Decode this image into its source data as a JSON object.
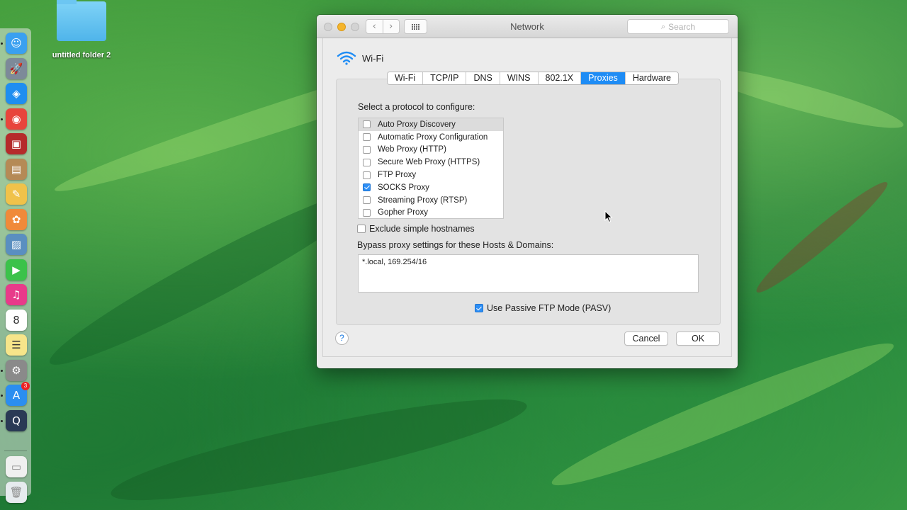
{
  "desktop": {
    "folder_label": "untitled folder 2"
  },
  "dock": {
    "items": [
      {
        "name": "finder",
        "glyph": "☺",
        "color": "#3aa0f0",
        "running": true
      },
      {
        "name": "launchpad",
        "glyph": "🚀",
        "color": "#7d8a99",
        "running": false
      },
      {
        "name": "safari",
        "glyph": "◈",
        "color": "#1f8ef0",
        "running": false
      },
      {
        "name": "chrome",
        "glyph": "◉",
        "color": "#e8453c",
        "running": true
      },
      {
        "name": "photo-booth",
        "glyph": "▣",
        "color": "#b52b2b",
        "running": false
      },
      {
        "name": "contacts",
        "glyph": "▤",
        "color": "#b58a56",
        "running": false
      },
      {
        "name": "notes-pencil",
        "glyph": "✎",
        "color": "#f0c24a",
        "running": false
      },
      {
        "name": "photos",
        "glyph": "✿",
        "color": "#f08a3a",
        "running": false
      },
      {
        "name": "preview",
        "glyph": "▨",
        "color": "#5a8fc0",
        "running": false
      },
      {
        "name": "facetime",
        "glyph": "▶",
        "color": "#3bc24a",
        "running": false
      },
      {
        "name": "itunes",
        "glyph": "♫",
        "color": "#e83a8a",
        "running": false
      },
      {
        "name": "calendar",
        "glyph": "8",
        "color": "#ffffff",
        "running": false
      },
      {
        "name": "notes",
        "glyph": "☰",
        "color": "#f6e58a",
        "running": false
      },
      {
        "name": "system-preferences",
        "glyph": "⚙",
        "color": "#8a8a8a",
        "running": true
      },
      {
        "name": "app-store",
        "glyph": "A",
        "color": "#2b8ef0",
        "running": true,
        "badge": "3"
      },
      {
        "name": "quicktime",
        "glyph": "Q",
        "color": "#2a3a55",
        "running": true
      }
    ],
    "bottom_items": [
      {
        "name": "downloads-stack",
        "glyph": "▭",
        "color": "#f0f0f0"
      },
      {
        "name": "trash",
        "glyph": "🗑",
        "color": "#e6ebee"
      }
    ]
  },
  "window": {
    "title": "Network",
    "search_placeholder": "Search",
    "interface_name": "Wi-Fi",
    "tabs": [
      {
        "label": "Wi-Fi",
        "active": false
      },
      {
        "label": "TCP/IP",
        "active": false
      },
      {
        "label": "DNS",
        "active": false
      },
      {
        "label": "WINS",
        "active": false
      },
      {
        "label": "802.1X",
        "active": false
      },
      {
        "label": "Proxies",
        "active": true
      },
      {
        "label": "Hardware",
        "active": false
      }
    ],
    "select_protocol_label": "Select a protocol to configure:",
    "protocols": [
      {
        "label": "Auto Proxy Discovery",
        "checked": false,
        "highlighted": true
      },
      {
        "label": "Automatic Proxy Configuration",
        "checked": false,
        "highlighted": false
      },
      {
        "label": "Web Proxy (HTTP)",
        "checked": false,
        "highlighted": false
      },
      {
        "label": "Secure Web Proxy (HTTPS)",
        "checked": false,
        "highlighted": false
      },
      {
        "label": "FTP Proxy",
        "checked": false,
        "highlighted": false
      },
      {
        "label": "SOCKS Proxy",
        "checked": true,
        "highlighted": false
      },
      {
        "label": "Streaming Proxy (RTSP)",
        "checked": false,
        "highlighted": false
      },
      {
        "label": "Gopher Proxy",
        "checked": false,
        "highlighted": false
      }
    ],
    "exclude_simple_hostnames": {
      "label": "Exclude simple hostnames",
      "checked": false
    },
    "bypass_label": "Bypass proxy settings for these Hosts & Domains:",
    "bypass_value": "*.local, 169.254/16",
    "passive_ftp": {
      "label": "Use Passive FTP Mode (PASV)",
      "checked": true
    },
    "help_label": "?",
    "cancel_label": "Cancel",
    "ok_label": "OK"
  },
  "colors": {
    "accent": "#1e8cf5",
    "wallpaper": "#2c8a3c",
    "wifi_icon": "#1e8cf5"
  }
}
